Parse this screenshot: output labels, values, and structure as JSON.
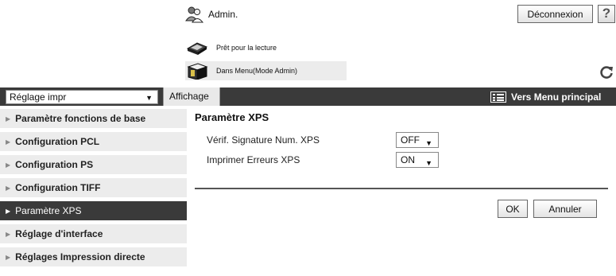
{
  "header": {
    "user_label": "Admin.",
    "logout_label": "Déconnexion",
    "help_label": "?",
    "status": [
      {
        "text": "Prêt pour la lecture",
        "icon": "scanner-icon"
      },
      {
        "text": "Dans Menu(Mode Admin)",
        "icon": "printer-icon"
      }
    ],
    "refresh_icon": "refresh-icon"
  },
  "toolbar": {
    "mode_select_value": "Réglage impr",
    "display_tab": "Affichage",
    "menu_link": "Vers Menu principal"
  },
  "sidebar": {
    "items": [
      {
        "label": "Paramètre fonctions de base",
        "active": false
      },
      {
        "label": "Configuration PCL",
        "active": false
      },
      {
        "label": "Configuration PS",
        "active": false
      },
      {
        "label": "Configuration TIFF",
        "active": false
      },
      {
        "label": "Paramètre XPS",
        "active": true
      },
      {
        "label": "Réglage d'interface",
        "active": false
      },
      {
        "label": "Réglages Impression directe",
        "active": false
      }
    ]
  },
  "content": {
    "title": "Paramètre XPS",
    "fields": [
      {
        "label": "Vérif. Signature Num. XPS",
        "value": "OFF"
      },
      {
        "label": "Imprimer Erreurs XPS",
        "value": "ON"
      }
    ],
    "ok_label": "OK",
    "cancel_label": "Annuler"
  },
  "colors": {
    "toolbar_bg": "#3a3a3a",
    "sidebar_bg": "#ececec",
    "active_bg": "#3a3a3a"
  }
}
